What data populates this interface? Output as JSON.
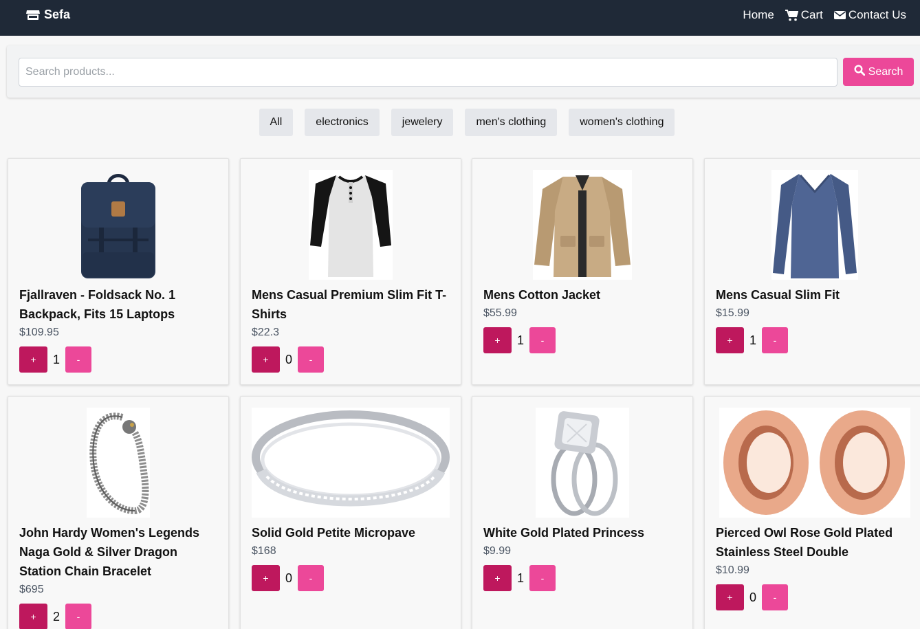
{
  "navbar": {
    "brand": "Sefa",
    "links": [
      "Home",
      "Cart",
      "Contact Us"
    ]
  },
  "search": {
    "placeholder": "Search products...",
    "button_label": "Search"
  },
  "filters": [
    "All",
    "electronics",
    "jewelery",
    "men's clothing",
    "women's clothing"
  ],
  "products": [
    {
      "title": "Fjallraven - Foldsack No. 1 Backpack, Fits 15 Laptops",
      "price": "$109.95",
      "qty": "1",
      "image": "backpack"
    },
    {
      "title": "Mens Casual Premium Slim Fit T-Shirts",
      "price": "$22.3",
      "qty": "0",
      "image": "raglan-tshirt"
    },
    {
      "title": "Mens Cotton Jacket",
      "price": "$55.99",
      "qty": "1",
      "image": "cotton-jacket"
    },
    {
      "title": "Mens Casual Slim Fit",
      "price": "$15.99",
      "qty": "1",
      "image": "long-sleeve-shirt"
    },
    {
      "title": "John Hardy Women's Legends Naga Gold & Silver Dragon Station Chain Bracelet",
      "price": "$695",
      "qty": "2",
      "image": "dragon-bracelet"
    },
    {
      "title": "Solid Gold Petite Micropave",
      "price": "$168",
      "qty": "0",
      "image": "micropave-ring"
    },
    {
      "title": "White Gold Plated Princess",
      "price": "$9.99",
      "qty": "1",
      "image": "princess-ring"
    },
    {
      "title": "Pierced Owl Rose Gold Plated Stainless Steel Double",
      "price": "$10.99",
      "qty": "0",
      "image": "rose-gold-tunnels"
    }
  ],
  "controls": {
    "plus": "+",
    "minus": "-"
  },
  "colors": {
    "navbar": "#1f2937",
    "accent": "#ec4899",
    "accent_dark": "#be185d"
  }
}
